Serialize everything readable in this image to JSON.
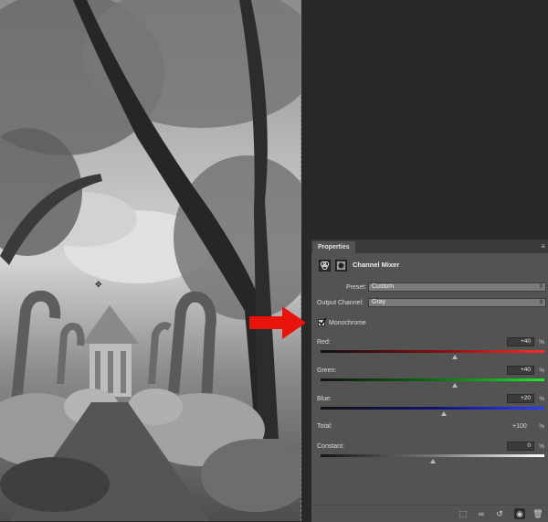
{
  "panel": {
    "tab_label": "Properties",
    "menu_icon": "panel-menu-icon",
    "title": "Channel Mixer",
    "preset_label": "Preset:",
    "preset_value": "Custom",
    "output_label": "Output Channel:",
    "output_value": "Gray",
    "monochrome_label": "Monochrome",
    "monochrome_checked": true,
    "channels": [
      {
        "label": "Red:",
        "value": "+40",
        "unit": "%",
        "level_percent": 40
      },
      {
        "label": "Green:",
        "value": "+40",
        "unit": "%",
        "level_percent": 40
      },
      {
        "label": "Blue:",
        "value": "+20",
        "unit": "%",
        "level_percent": 20
      }
    ],
    "total_label": "Total:",
    "total_value": "+100",
    "total_unit": "%",
    "constant_label": "Constant:",
    "constant_value": "0",
    "constant_unit": "%",
    "constant_level_percent": 0
  },
  "colors": {
    "arrow": "#e8140c",
    "panel_bg": "#535353",
    "canvas_bg": "#282828"
  }
}
